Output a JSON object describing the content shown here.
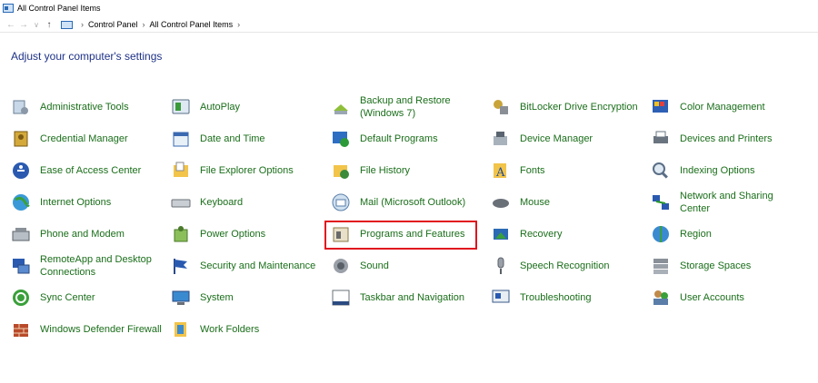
{
  "window": {
    "title": "All Control Panel Items"
  },
  "address": {
    "crumbs": [
      "Control Panel",
      "All Control Panel Items"
    ]
  },
  "heading": "Adjust your computer's settings",
  "items": [
    {
      "label": "Administrative Tools",
      "icon": "admin-tools-icon"
    },
    {
      "label": "AutoPlay",
      "icon": "autoplay-icon"
    },
    {
      "label": "Backup and Restore (Windows 7)",
      "icon": "backup-icon"
    },
    {
      "label": "BitLocker Drive Encryption",
      "icon": "bitlocker-icon"
    },
    {
      "label": "Color Management",
      "icon": "color-management-icon"
    },
    {
      "label": "Credential Manager",
      "icon": "credential-icon"
    },
    {
      "label": "Date and Time",
      "icon": "calendar-icon"
    },
    {
      "label": "Default Programs",
      "icon": "default-programs-icon"
    },
    {
      "label": "Device Manager",
      "icon": "device-manager-icon"
    },
    {
      "label": "Devices and Printers",
      "icon": "printer-icon"
    },
    {
      "label": "Ease of Access Center",
      "icon": "accessibility-icon"
    },
    {
      "label": "File Explorer Options",
      "icon": "folder-options-icon"
    },
    {
      "label": "File History",
      "icon": "file-history-icon"
    },
    {
      "label": "Fonts",
      "icon": "fonts-icon"
    },
    {
      "label": "Indexing Options",
      "icon": "magnifier-icon"
    },
    {
      "label": "Internet Options",
      "icon": "globe-icon"
    },
    {
      "label": "Keyboard",
      "icon": "keyboard-icon"
    },
    {
      "label": "Mail (Microsoft Outlook)",
      "icon": "mail-icon"
    },
    {
      "label": "Mouse",
      "icon": "mouse-icon"
    },
    {
      "label": "Network and Sharing Center",
      "icon": "network-icon"
    },
    {
      "label": "Phone and Modem",
      "icon": "phone-icon"
    },
    {
      "label": "Power Options",
      "icon": "power-icon"
    },
    {
      "label": "Programs and Features",
      "icon": "programs-icon"
    },
    {
      "label": "Recovery",
      "icon": "recovery-icon"
    },
    {
      "label": "Region",
      "icon": "region-globe-icon"
    },
    {
      "label": "RemoteApp and Desktop Connections",
      "icon": "remote-desktop-icon"
    },
    {
      "label": "Security and Maintenance",
      "icon": "flag-icon"
    },
    {
      "label": "Sound",
      "icon": "speaker-icon"
    },
    {
      "label": "Speech Recognition",
      "icon": "microphone-icon"
    },
    {
      "label": "Storage Spaces",
      "icon": "storage-icon"
    },
    {
      "label": "Sync Center",
      "icon": "sync-icon"
    },
    {
      "label": "System",
      "icon": "system-icon"
    },
    {
      "label": "Taskbar and Navigation",
      "icon": "taskbar-icon"
    },
    {
      "label": "Troubleshooting",
      "icon": "troubleshoot-icon"
    },
    {
      "label": "User Accounts",
      "icon": "users-icon"
    },
    {
      "label": "Windows Defender Firewall",
      "icon": "firewall-icon"
    },
    {
      "label": "Work Folders",
      "icon": "work-folders-icon"
    }
  ],
  "colors": {
    "link": "#1a6e1a",
    "heading": "#1e3287",
    "highlight": "#e0141e"
  }
}
